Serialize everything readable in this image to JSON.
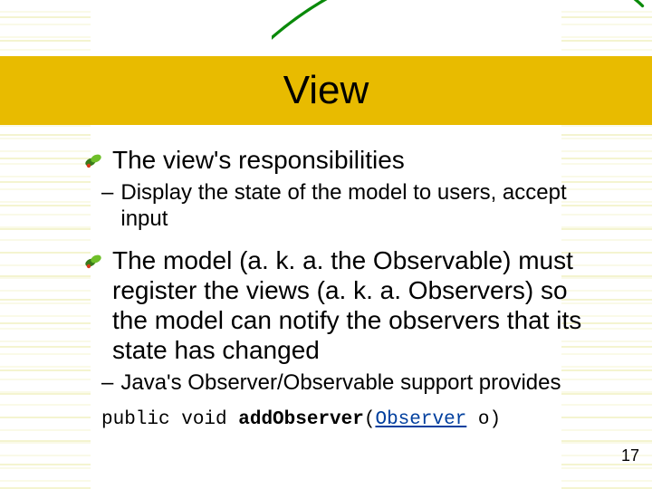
{
  "slide": {
    "title": "View",
    "bullets": [
      {
        "text": "The view's responsibilities",
        "subs": [
          "Display the state of the model to users, accept input"
        ]
      },
      {
        "text": "The model (a. k. a. the Observable) must register the views (a. k. a. Observers) so the model can notify the observers that its state has changed",
        "subs": [
          "Java's Observer/Observable support provides"
        ]
      }
    ],
    "code": {
      "prefix": "public void ",
      "method": "addObserver",
      "open": "(",
      "param_type": "Observer",
      "rest": " o)"
    },
    "page_number": "17"
  }
}
